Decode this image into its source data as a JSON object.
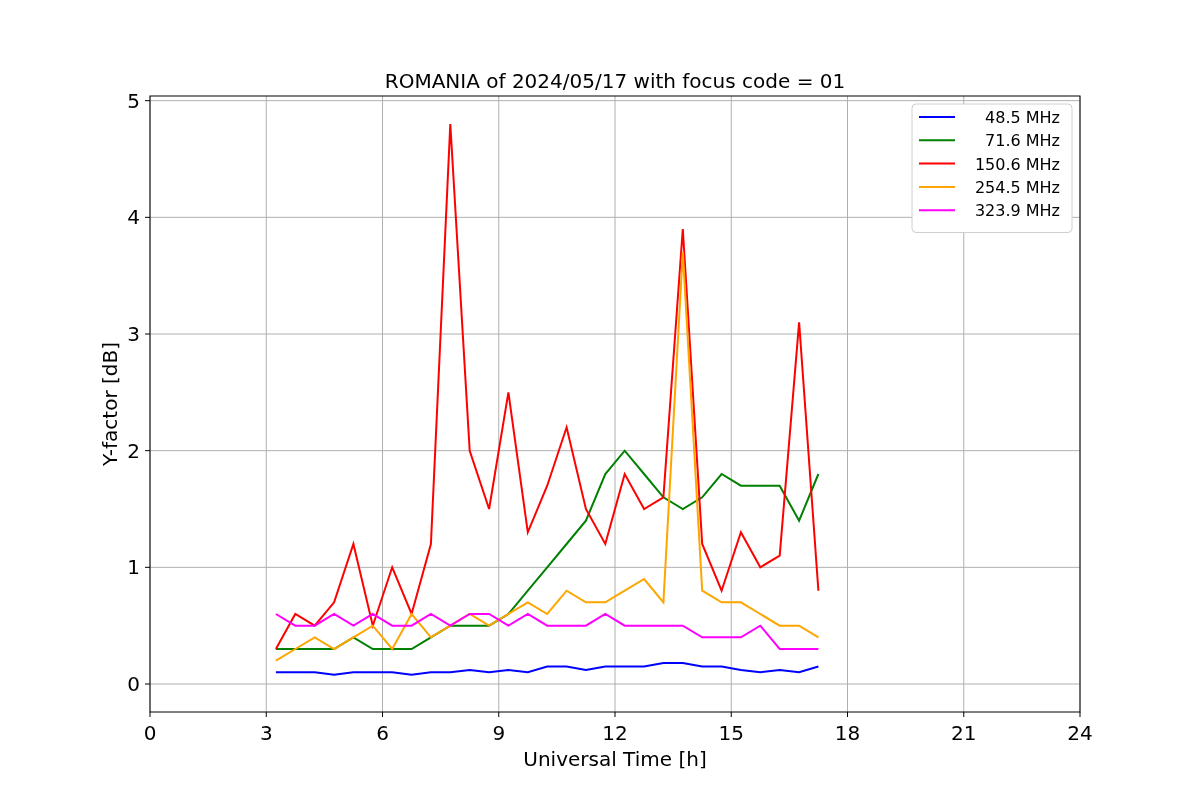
{
  "chart_data": {
    "type": "line",
    "title": "ROMANIA of 2024/05/17 with focus code = 01",
    "xlabel": "Universal Time [h]",
    "ylabel": "Y-factor [dB]",
    "x": [
      3.25,
      3.75,
      4.25,
      4.75,
      5.25,
      5.75,
      6.25,
      6.75,
      7.25,
      7.75,
      8.25,
      8.75,
      9.25,
      9.75,
      10.25,
      10.75,
      11.25,
      11.75,
      12.25,
      12.75,
      13.25,
      13.75,
      14.25,
      14.75,
      15.25,
      15.75,
      16.25,
      16.75,
      17.25
    ],
    "series": [
      {
        "name": "48.5 MHz",
        "color": "#0000ff",
        "values": [
          0.1,
          0.1,
          0.1,
          0.08,
          0.1,
          0.1,
          0.1,
          0.08,
          0.1,
          0.1,
          0.12,
          0.1,
          0.12,
          0.1,
          0.15,
          0.15,
          0.12,
          0.15,
          0.15,
          0.15,
          0.18,
          0.18,
          0.15,
          0.15,
          0.12,
          0.1,
          0.12,
          0.1,
          0.15
        ]
      },
      {
        "name": "71.6 MHz",
        "color": "#008000",
        "values": [
          0.3,
          0.3,
          0.3,
          0.3,
          0.4,
          0.3,
          0.3,
          0.3,
          0.4,
          0.5,
          0.5,
          0.5,
          0.6,
          0.8,
          1.0,
          1.2,
          1.4,
          1.8,
          2.0,
          1.8,
          1.6,
          1.5,
          1.6,
          1.8,
          1.7,
          1.7,
          1.7,
          1.4,
          1.8
        ]
      },
      {
        "name": "150.6 MHz",
        "color": "#ff0000",
        "values": [
          0.3,
          0.6,
          0.5,
          0.7,
          1.2,
          0.5,
          1.0,
          0.6,
          1.2,
          4.8,
          2.0,
          1.5,
          2.5,
          1.3,
          1.7,
          2.2,
          1.5,
          1.2,
          1.8,
          1.5,
          1.6,
          3.9,
          1.2,
          0.8,
          1.3,
          1.0,
          1.1,
          3.1,
          0.8
        ]
      },
      {
        "name": "254.5 MHz",
        "color": "#ffa500",
        "values": [
          0.2,
          0.3,
          0.4,
          0.3,
          0.4,
          0.5,
          0.3,
          0.6,
          0.4,
          0.5,
          0.6,
          0.5,
          0.6,
          0.7,
          0.6,
          0.8,
          0.7,
          0.7,
          0.8,
          0.9,
          0.7,
          3.7,
          0.8,
          0.7,
          0.7,
          0.6,
          0.5,
          0.5,
          0.4
        ]
      },
      {
        "name": "323.9 MHz",
        "color": "#ff00ff",
        "values": [
          0.6,
          0.5,
          0.5,
          0.6,
          0.5,
          0.6,
          0.5,
          0.5,
          0.6,
          0.5,
          0.6,
          0.6,
          0.5,
          0.6,
          0.5,
          0.5,
          0.5,
          0.6,
          0.5,
          0.5,
          0.5,
          0.5,
          0.4,
          0.4,
          0.4,
          0.5,
          0.3,
          0.3,
          0.3
        ]
      }
    ],
    "grid": true,
    "legend": true,
    "xlim": [
      0,
      24
    ],
    "ylim": [
      -0.24,
      5.04
    ],
    "xticks": [
      0,
      3,
      6,
      9,
      12,
      15,
      18,
      21,
      24
    ],
    "yticks": [
      0,
      1,
      2,
      3,
      4,
      5
    ]
  }
}
